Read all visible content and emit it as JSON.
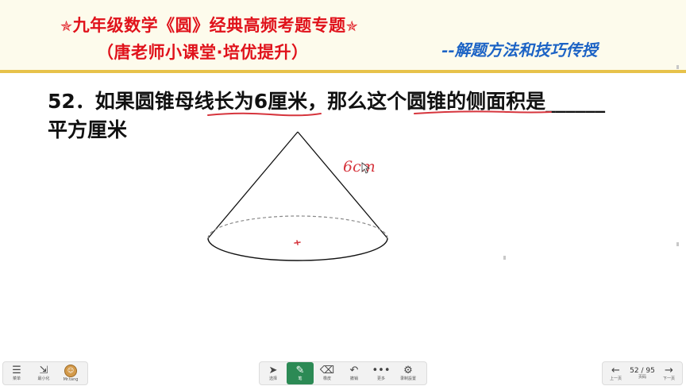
{
  "header": {
    "title_main": "九年级数学《圆》经典高频考题专题",
    "title_sub": "（唐老师小课堂·培优提升）",
    "tagline": "--解题方法和技巧传授",
    "star_icon": "star-icon"
  },
  "question": {
    "line1": "52．如果圆锥母线长为6厘米，那么这个圆锥的侧面积是______",
    "line2": "平方厘米"
  },
  "annotation": {
    "handwriting": "6cm"
  },
  "toolbar": {
    "left": {
      "menu_label": "菜单",
      "minimize_label": "最小化",
      "user_label": "Mr.tang"
    },
    "tools": {
      "select_label": "选择",
      "pen_label": "笔",
      "eraser_label": "橡皮",
      "undo_label": "撤销",
      "more_label": "更多",
      "record_label": "录制設置"
    },
    "nav": {
      "prev_label": "上一页",
      "page_label": "页码",
      "page_indicator": "52 / 95",
      "next_label": "下一页"
    }
  },
  "colors": {
    "title": "#e0121b",
    "tagline": "#1c63c5",
    "header_bg": "#fdfbec",
    "header_line": "#e7c24a",
    "ink": "#d6353d",
    "pen_active": "#2c8a55"
  }
}
